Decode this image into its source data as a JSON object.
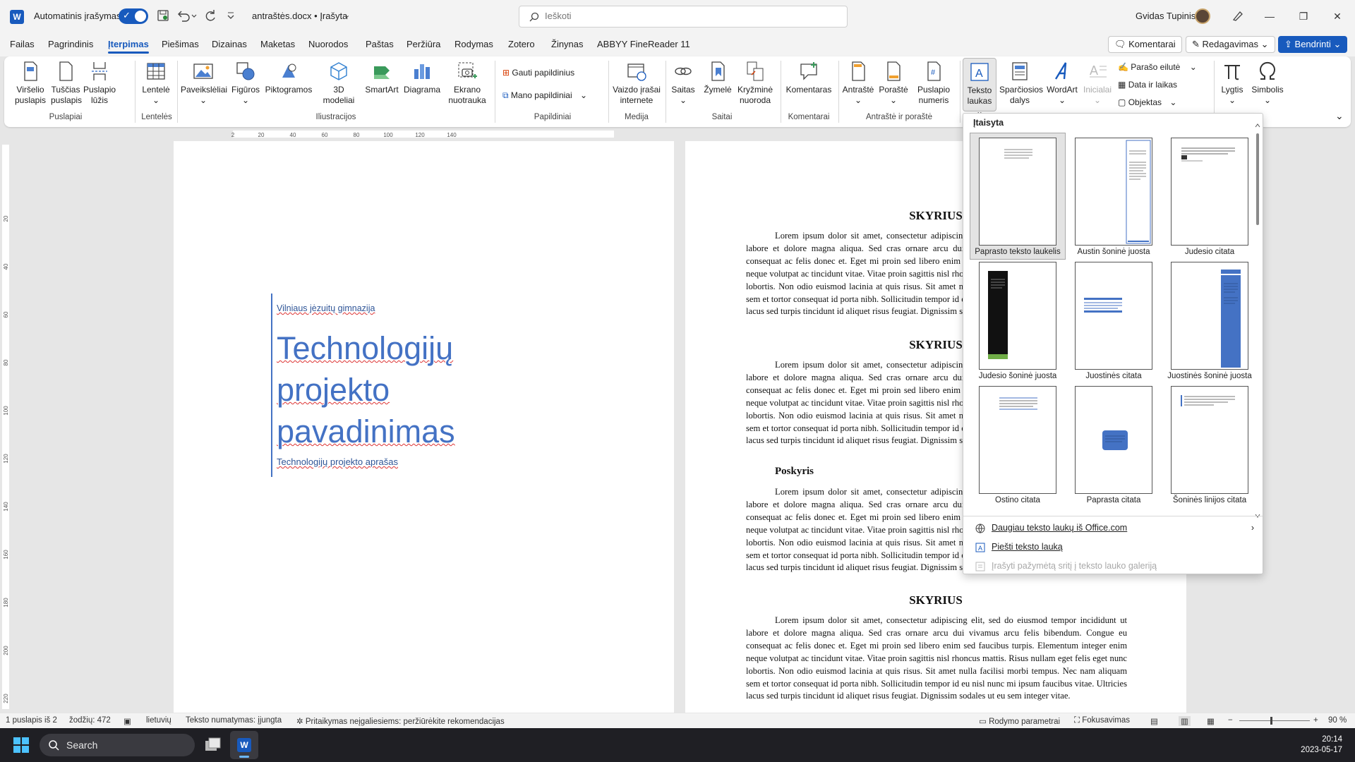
{
  "titlebar": {
    "app_letter": "W",
    "autosave_label": "Automatinis įrašymas",
    "doc_title": "antraštės.docx • Įrašyta",
    "search_placeholder": "Ieškoti",
    "user_name": "Gvidas Tupinis"
  },
  "menu": {
    "tabs": [
      "Failas",
      "Pagrindinis",
      "Įterpimas",
      "Piešimas",
      "Dizainas",
      "Maketas",
      "Nuorodos",
      "Paštas",
      "Peržiūra",
      "Rodymas",
      "Zotero",
      "Žinynas",
      "ABBYY FineReader 11"
    ],
    "active_tab": "Įterpimas",
    "comments": "Komentarai",
    "editing": "Redagavimas",
    "share": "Bendrinti"
  },
  "ribbon": {
    "cover_page": "Viršelio puslapis",
    "blank_page": "Tuščias puslapis",
    "page_break": "Puslapio lūžis",
    "table": "Lentelė",
    "pictures": "Paveikslėliai",
    "shapes": "Figūros",
    "icons": "Piktogramos",
    "models3d": "3D modeliai",
    "smartart": "SmartArt",
    "chart": "Diagrama",
    "screenshot": "Ekrano nuotrauka",
    "get_addins": "Gauti papildinius",
    "my_addins": "Mano papildiniai",
    "online_video": "Vaizdo įrašai internete",
    "link": "Saitas",
    "bookmark": "Žymelė",
    "cross_ref": "Kryžminė nuoroda",
    "comment": "Komentaras",
    "header": "Antraštė",
    "footer": "Poraštė",
    "page_number": "Puslapio numeris",
    "text_box": "Teksto laukas",
    "quick_parts": "Sparčiosios dalys",
    "wordart": "WordArt",
    "drop_cap": "Inicialai",
    "signature_line": "Parašo eilutė",
    "date_time": "Data ir laikas",
    "object": "Objektas",
    "equation": "Lygtis",
    "symbol": "Simbolis",
    "groups": {
      "pages": "Puslapiai",
      "tables": "Lentelės",
      "illustrations": "Iliustracijos",
      "addins": "Papildiniai",
      "media": "Medija",
      "links": "Saitai",
      "comments": "Komentarai",
      "header_footer": "Antraštė ir poraštė"
    }
  },
  "ruler": {
    "h_ticks": [
      "2",
      "20",
      "40",
      "60",
      "80",
      "100",
      "120",
      "140"
    ],
    "v_ticks": [
      "20",
      "40",
      "60",
      "80",
      "100",
      "120",
      "140",
      "160",
      "180",
      "200",
      "220"
    ]
  },
  "page1": {
    "school": "Vilniaus jėzuitų gimnazija",
    "title": "Technologijų projekto pavadinimas",
    "subtitle": "Technologijų projekto aprašas"
  },
  "page2": {
    "heading": "SKYRIUS",
    "subheading": "Poskyris",
    "lorem": "Lorem ipsum dolor sit amet, consectetur adipiscing elit, sed do eiusmod tempor incididunt ut labore et dolore magna aliqua. Sed cras ornare arcu dui vivamus arcu felis bibendum. Congue eu consequat ac felis donec et. Eget mi proin sed libero enim sed faucibus turpis. Elementum integer enim neque volutpat ac tincidunt vitae. Vitae proin sagittis nisl rhoncus mattis. Risus nullam eget felis eget nunc lobortis. Non odio euismod lacinia at quis risus. Sit amet nulla facilisi morbi tempus. Nec nam aliquam sem et tortor consequat id porta nibh. Sollicitudin tempor id eu nisl nunc mi ipsum faucibus vitae. Ultricies lacus sed turpis tincidunt id aliquet risus feugiat. Dignissim sodales ut eu sem integer vitae."
  },
  "gallery": {
    "title": "Įtaisyta",
    "items": [
      "Paprasto teksto laukelis",
      "Austin šoninė juosta",
      "Judesio citata",
      "Judesio šoninė juosta",
      "Juostinės citata",
      "Juostinės šoninė juosta",
      "Ostino citata",
      "Paprasta citata",
      "Šoninės linijos citata"
    ],
    "more": "Daugiau teksto laukų iš Office.com",
    "draw": "Piešti teksto lauką",
    "save": "Įrašyti pažymėtą sritį į teksto lauko galeriją"
  },
  "status": {
    "page": "1 puslapis iš 2",
    "words": "žodžių: 472",
    "language": "lietuvių",
    "predictions": "Teksto numatymas: įjungta",
    "accessibility": "Pritaikymas neįgaliesiems: peržiūrėkite rekomendacijas",
    "display": "Rodymo parametrai",
    "focus": "Fokusavimas",
    "zoom": "90 %"
  },
  "taskbar": {
    "search": "Search",
    "time": "20:14",
    "date": "2023-05-17"
  },
  "colors": {
    "accent": "#185abd",
    "title_blue": "#4472c4",
    "spell_red": "#d33"
  }
}
